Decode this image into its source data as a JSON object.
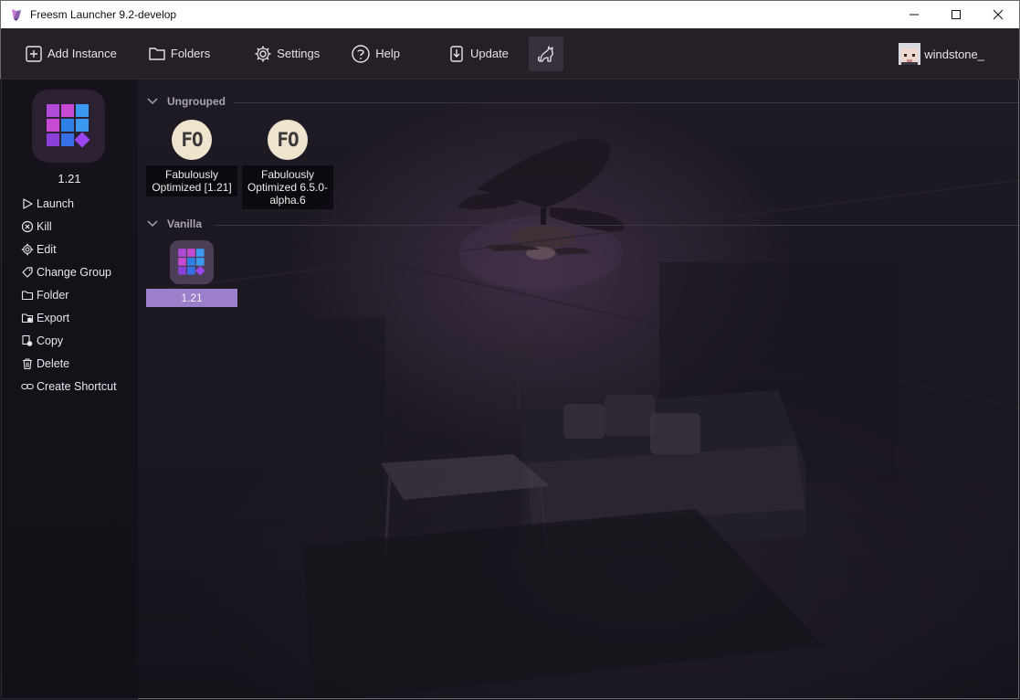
{
  "window": {
    "title": "Freesm Launcher 9.2-develop"
  },
  "toolbar": {
    "add_instance": "Add Instance",
    "folders": "Folders",
    "settings": "Settings",
    "help": "Help",
    "update": "Update",
    "account_name": "windstone_"
  },
  "sidebar": {
    "instance_name": "1.21",
    "actions": [
      {
        "label": "Launch",
        "icon": "play-icon"
      },
      {
        "label": "Kill",
        "icon": "kill-icon"
      },
      {
        "label": "Edit",
        "icon": "gear-icon"
      },
      {
        "label": "Change Group",
        "icon": "tag-icon"
      },
      {
        "label": "Folder",
        "icon": "folder-icon"
      },
      {
        "label": "Export",
        "icon": "export-icon"
      },
      {
        "label": "Copy",
        "icon": "copy-icon"
      },
      {
        "label": "Delete",
        "icon": "trash-icon"
      },
      {
        "label": "Create Shortcut",
        "icon": "link-icon"
      }
    ]
  },
  "groups": [
    {
      "name": "Ungrouped",
      "instances": [
        {
          "badge": "FO",
          "label": "Fabulously Optimized [1.21]"
        },
        {
          "badge": "FO",
          "label": "Fabulously Optimized 6.5.0-alpha.6"
        }
      ]
    },
    {
      "name": "Vanilla",
      "instances": [
        {
          "label": "1.21",
          "selected": true
        }
      ]
    }
  ],
  "colors": {
    "accent": "#9c7fca",
    "toolbar_bg": "#242026",
    "sidebar_bg": "#120f16"
  }
}
